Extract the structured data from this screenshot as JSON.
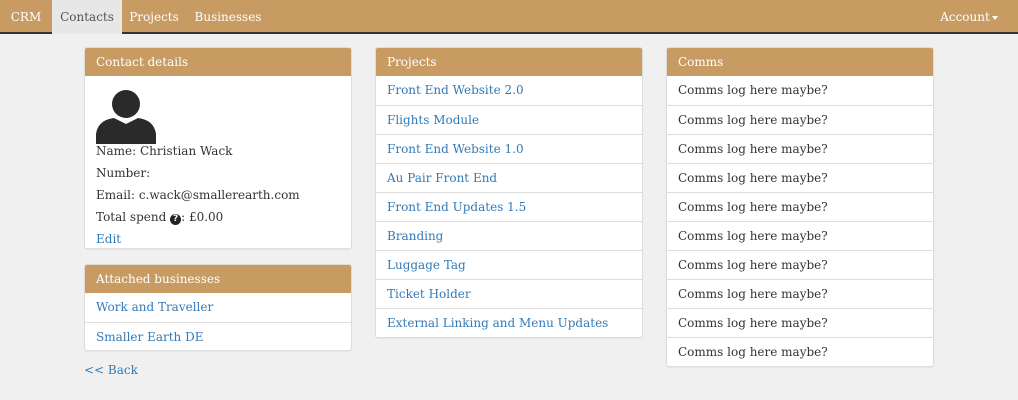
{
  "navbar": {
    "brand": "CRM",
    "items": [
      {
        "label": "Contacts",
        "active": true
      },
      {
        "label": "Projects",
        "active": false
      },
      {
        "label": "Businesses",
        "active": false
      }
    ],
    "account_label": "Account"
  },
  "contact": {
    "heading": "Contact details",
    "name_line": "Name: Christian Wack",
    "number_line": "Number:",
    "email_line": "Email: c.wack@smallerearth.com",
    "spend_prefix": "Total spend",
    "spend_value": ": £0.00",
    "edit_label": "Edit"
  },
  "businesses": {
    "heading": "Attached businesses",
    "items": [
      "Work and Traveller",
      "Smaller Earth DE"
    ]
  },
  "projects": {
    "heading": "Projects",
    "items": [
      "Front End Website 2.0",
      "Flights Module",
      "Front End Website 1.0",
      "Au Pair Front End",
      "Front End Updates 1.5",
      "Branding",
      "Luggage Tag",
      "Ticket Holder",
      "External Linking and Menu Updates"
    ]
  },
  "comms": {
    "heading": "Comms",
    "items": [
      "Comms log here maybe?",
      "Comms log here maybe?",
      "Comms log here maybe?",
      "Comms log here maybe?",
      "Comms log here maybe?",
      "Comms log here maybe?",
      "Comms log here maybe?",
      "Comms log here maybe?",
      "Comms log here maybe?",
      "Comms log here maybe?"
    ]
  },
  "back_label": "<< Back",
  "colors": {
    "accent": "#c79b62",
    "link": "#337ab7",
    "active_tab": "#e7e7e7"
  },
  "icons": {
    "avatar": "user-silhouette",
    "spend_info": "question-circle-icon"
  }
}
